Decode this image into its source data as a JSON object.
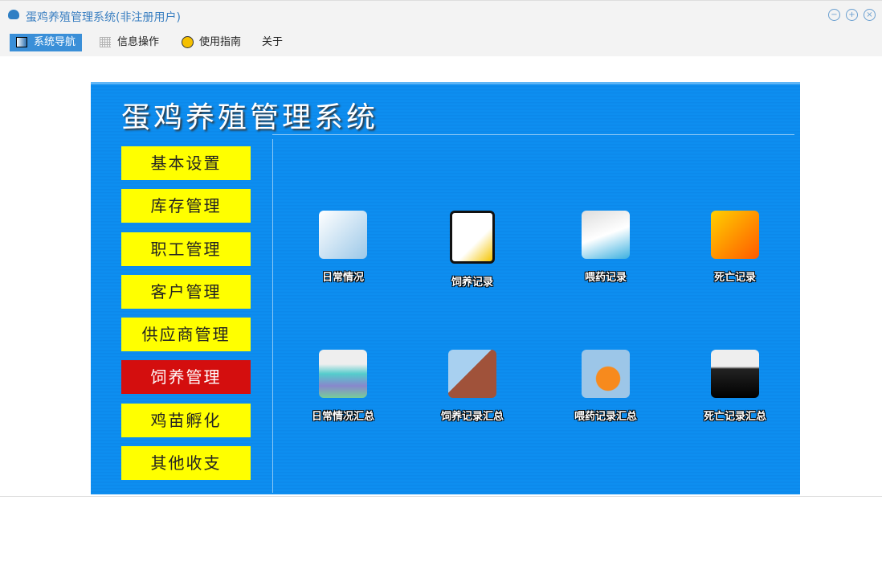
{
  "window": {
    "title": "蛋鸡养殖管理系统(非注册用户)",
    "controls": [
      "minimize",
      "maximize",
      "close"
    ]
  },
  "menu": [
    {
      "label": "系统导航",
      "icon": "window-icon",
      "active": true
    },
    {
      "label": "信息操作",
      "icon": "grid-icon"
    },
    {
      "label": "使用指南",
      "icon": "help-icon"
    },
    {
      "label": "关于"
    }
  ],
  "panel": {
    "title": "蛋鸡养殖管理系统"
  },
  "nav": [
    {
      "label": "基本设置"
    },
    {
      "label": "库存管理"
    },
    {
      "label": "职工管理"
    },
    {
      "label": "客户管理"
    },
    {
      "label": "供应商管理"
    },
    {
      "label": "饲养管理",
      "selected": true
    },
    {
      "label": "鸡苗孵化"
    },
    {
      "label": "其他收支"
    }
  ],
  "tiles": [
    {
      "label": "日常情况",
      "icon": "document-pen-icon"
    },
    {
      "label": "饲养记录",
      "icon": "note-pencil-icon"
    },
    {
      "label": "喂药记录",
      "icon": "scroll-pen-icon"
    },
    {
      "label": "死亡记录",
      "icon": "orange-folder-icon"
    },
    {
      "label": "日常情况汇总",
      "icon": "books-lamp-icon"
    },
    {
      "label": "饲养记录汇总",
      "icon": "folder-wall-icon"
    },
    {
      "label": "喂药记录汇总",
      "icon": "folder-rss-icon"
    },
    {
      "label": "死亡记录汇总",
      "icon": "black-folder-icon"
    }
  ]
}
